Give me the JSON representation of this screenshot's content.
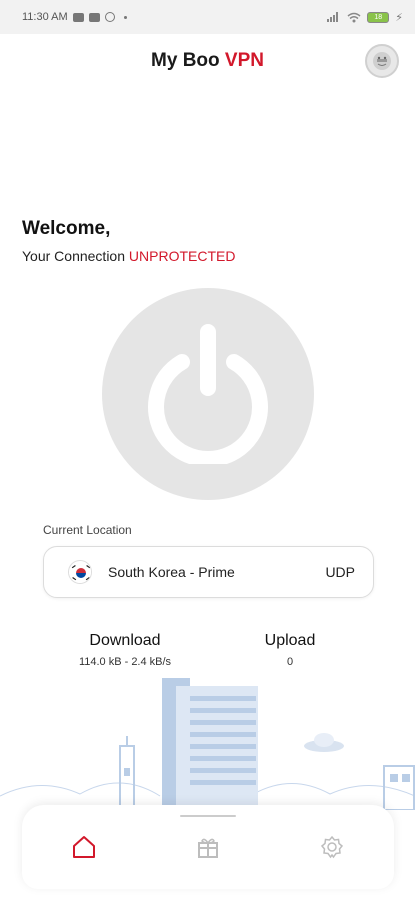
{
  "status_bar": {
    "time": "11:30 AM",
    "battery": "18"
  },
  "header": {
    "title_main": "My Boo ",
    "title_accent": "VPN"
  },
  "welcome": {
    "heading": "Welcome,",
    "connection_prefix": "Your Connection ",
    "connection_status": "UNPROTECTED"
  },
  "location": {
    "label": "Current Location",
    "server": "South Korea - Prime",
    "protocol": "UDP",
    "flag_icon": "south-korea-flag-icon"
  },
  "stats": {
    "download_label": "Download",
    "download_value": "114.0 kB - 2.4 kB/s",
    "upload_label": "Upload",
    "upload_value": "0"
  },
  "colors": {
    "accent": "#d2182b",
    "power_bg": "#e5e5e5",
    "city": "#b9cde6"
  },
  "nav": {
    "items": [
      "home-icon",
      "gift-icon",
      "badge-icon"
    ],
    "active": "home-icon"
  }
}
